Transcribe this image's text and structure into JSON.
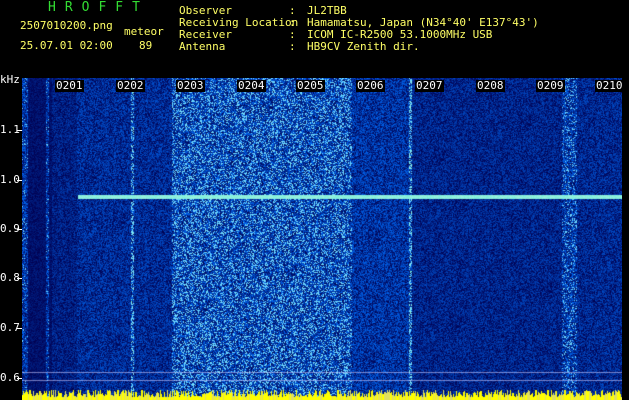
{
  "header": {
    "title": "HROFFT",
    "filename": "2507010200.png",
    "datetime": "25.07.01 02:00",
    "meteor_label": "meteor",
    "meteor_count": "89",
    "info": [
      {
        "label": "Observer",
        "sep": ":",
        "value": "JL2TBB"
      },
      {
        "label": "Receiving Location",
        "sep": ":",
        "value": "Hamamatsu, Japan (N34°40' E137°43')"
      },
      {
        "label": "Receiver",
        "sep": ":",
        "value": "ICOM IC-R2500 53.1000MHz USB"
      },
      {
        "label": "Antenna",
        "sep": ":",
        "value": "HB9CV Zenith dir."
      }
    ]
  },
  "spectrogram": {
    "y_unit": "kHz",
    "y_ticks": [
      "1.1",
      "1.0",
      "0.9",
      "0.8",
      "0.7",
      "0.6"
    ],
    "time_ticks": [
      "0201",
      "0202",
      "0203",
      "0204",
      "0205",
      "0206",
      "0207",
      "0208",
      "0209",
      "0210"
    ],
    "colors": {
      "background": "#000000",
      "noise_dark": "#0a0a7a",
      "noise_bright": "#3c7cff",
      "signal": "#7fffd4",
      "baseline": "#ffff00"
    }
  }
}
